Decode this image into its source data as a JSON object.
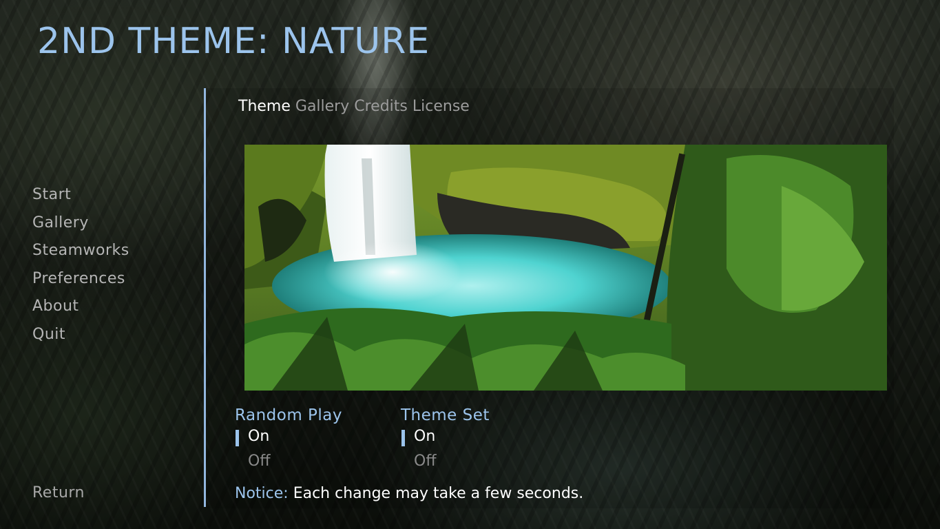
{
  "title": "2ND THEME: NATURE",
  "main_menu": {
    "items": [
      {
        "label": "Start"
      },
      {
        "label": "Gallery"
      },
      {
        "label": "Steamworks"
      },
      {
        "label": "Preferences"
      },
      {
        "label": "About"
      },
      {
        "label": "Quit"
      }
    ],
    "return_label": "Return"
  },
  "tabs": [
    {
      "label": "Theme",
      "active": true
    },
    {
      "label": "Gallery",
      "active": false
    },
    {
      "label": "Credits",
      "active": false
    },
    {
      "label": "License",
      "active": false
    }
  ],
  "preview": {
    "description_icon": "waterfall-preview-image"
  },
  "options": {
    "random_play": {
      "heading": "Random Play",
      "on": "On",
      "off": "Off",
      "selected": "On"
    },
    "theme_set": {
      "heading": "Theme Set",
      "on": "On",
      "off": "Off",
      "selected": "On"
    }
  },
  "notice": {
    "label": "Notice:",
    "text": "Each change may take a few seconds."
  },
  "colors": {
    "accent": "#9cc4ec",
    "active_text": "#ffffff",
    "inactive_text": "#9c9c9c"
  }
}
